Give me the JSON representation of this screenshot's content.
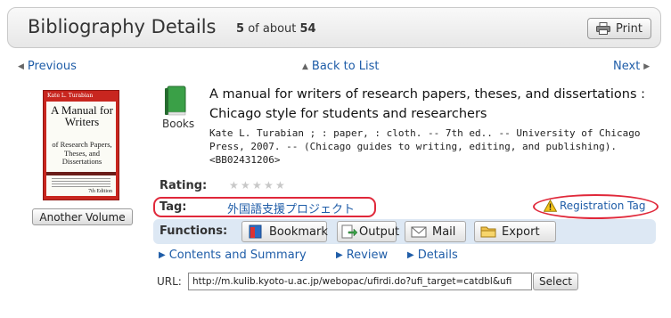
{
  "header": {
    "title": "Bibliography Details",
    "position": "5",
    "of_label": "of about",
    "total": "54",
    "print_label": "Print"
  },
  "nav": {
    "previous": "Previous",
    "back": "Back to List",
    "next": "Next"
  },
  "cover": {
    "author": "Kate L. Turabian",
    "title": "A Manual for Writers",
    "subtitle": "of Research Papers, Theses, and Dissertations",
    "edition": "7th Edition"
  },
  "another_volume": "Another Volume",
  "material_type": "Books",
  "record": {
    "title": "A manual for writers of research papers, theses, and dissertations : Chicago style for students and researchers",
    "description": "Kate L. Turabian ; : paper, : cloth. -- 7th ed.. -- University of Chicago Press, 2007. -- (Chicago guides to writing, editing, and publishing). <BB02431206>"
  },
  "rating": {
    "label": "Rating:",
    "value": 0,
    "max": 5
  },
  "tag": {
    "label": "Tag:",
    "value": "外国語支援プロジェクト"
  },
  "registration_tag": "Registration Tag",
  "functions": {
    "label": "Functions:",
    "bookmark": "Bookmark",
    "output": "Output",
    "mail": "Mail",
    "export": "Export"
  },
  "links": {
    "contents": "Contents and Summary",
    "review": "Review",
    "details": "Details"
  },
  "url": {
    "label": "URL:",
    "value": "http://m.kulib.kyoto-u.ac.jp/webopac/ufirdi.do?ufi_target=catdbl&ufi",
    "select": "Select"
  },
  "colors": {
    "link": "#1f5da8",
    "highlight": "#e0283a",
    "function_bar": "#dde8f4",
    "book_icon": "#3aa047"
  }
}
